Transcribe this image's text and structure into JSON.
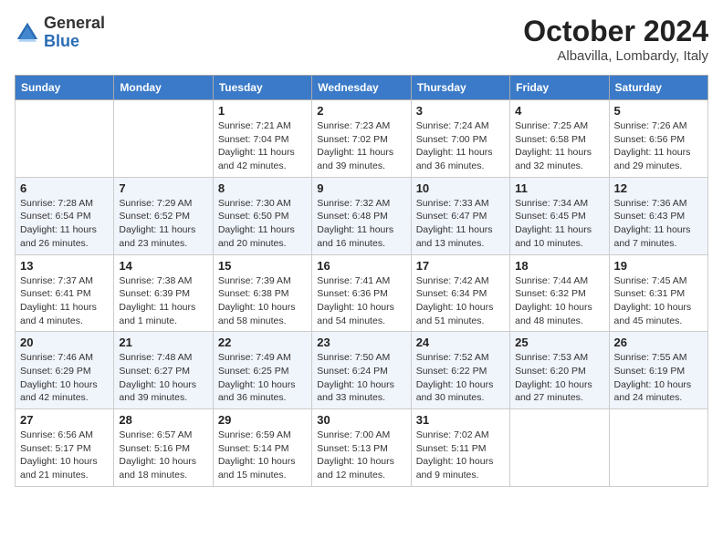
{
  "logo": {
    "general": "General",
    "blue": "Blue"
  },
  "title": "October 2024",
  "location": "Albavilla, Lombardy, Italy",
  "days_of_week": [
    "Sunday",
    "Monday",
    "Tuesday",
    "Wednesday",
    "Thursday",
    "Friday",
    "Saturday"
  ],
  "weeks": [
    [
      {
        "day": "",
        "details": ""
      },
      {
        "day": "",
        "details": ""
      },
      {
        "day": "1",
        "details": "Sunrise: 7:21 AM\nSunset: 7:04 PM\nDaylight: 11 hours and 42 minutes."
      },
      {
        "day": "2",
        "details": "Sunrise: 7:23 AM\nSunset: 7:02 PM\nDaylight: 11 hours and 39 minutes."
      },
      {
        "day": "3",
        "details": "Sunrise: 7:24 AM\nSunset: 7:00 PM\nDaylight: 11 hours and 36 minutes."
      },
      {
        "day": "4",
        "details": "Sunrise: 7:25 AM\nSunset: 6:58 PM\nDaylight: 11 hours and 32 minutes."
      },
      {
        "day": "5",
        "details": "Sunrise: 7:26 AM\nSunset: 6:56 PM\nDaylight: 11 hours and 29 minutes."
      }
    ],
    [
      {
        "day": "6",
        "details": "Sunrise: 7:28 AM\nSunset: 6:54 PM\nDaylight: 11 hours and 26 minutes."
      },
      {
        "day": "7",
        "details": "Sunrise: 7:29 AM\nSunset: 6:52 PM\nDaylight: 11 hours and 23 minutes."
      },
      {
        "day": "8",
        "details": "Sunrise: 7:30 AM\nSunset: 6:50 PM\nDaylight: 11 hours and 20 minutes."
      },
      {
        "day": "9",
        "details": "Sunrise: 7:32 AM\nSunset: 6:48 PM\nDaylight: 11 hours and 16 minutes."
      },
      {
        "day": "10",
        "details": "Sunrise: 7:33 AM\nSunset: 6:47 PM\nDaylight: 11 hours and 13 minutes."
      },
      {
        "day": "11",
        "details": "Sunrise: 7:34 AM\nSunset: 6:45 PM\nDaylight: 11 hours and 10 minutes."
      },
      {
        "day": "12",
        "details": "Sunrise: 7:36 AM\nSunset: 6:43 PM\nDaylight: 11 hours and 7 minutes."
      }
    ],
    [
      {
        "day": "13",
        "details": "Sunrise: 7:37 AM\nSunset: 6:41 PM\nDaylight: 11 hours and 4 minutes."
      },
      {
        "day": "14",
        "details": "Sunrise: 7:38 AM\nSunset: 6:39 PM\nDaylight: 11 hours and 1 minute."
      },
      {
        "day": "15",
        "details": "Sunrise: 7:39 AM\nSunset: 6:38 PM\nDaylight: 10 hours and 58 minutes."
      },
      {
        "day": "16",
        "details": "Sunrise: 7:41 AM\nSunset: 6:36 PM\nDaylight: 10 hours and 54 minutes."
      },
      {
        "day": "17",
        "details": "Sunrise: 7:42 AM\nSunset: 6:34 PM\nDaylight: 10 hours and 51 minutes."
      },
      {
        "day": "18",
        "details": "Sunrise: 7:44 AM\nSunset: 6:32 PM\nDaylight: 10 hours and 48 minutes."
      },
      {
        "day": "19",
        "details": "Sunrise: 7:45 AM\nSunset: 6:31 PM\nDaylight: 10 hours and 45 minutes."
      }
    ],
    [
      {
        "day": "20",
        "details": "Sunrise: 7:46 AM\nSunset: 6:29 PM\nDaylight: 10 hours and 42 minutes."
      },
      {
        "day": "21",
        "details": "Sunrise: 7:48 AM\nSunset: 6:27 PM\nDaylight: 10 hours and 39 minutes."
      },
      {
        "day": "22",
        "details": "Sunrise: 7:49 AM\nSunset: 6:25 PM\nDaylight: 10 hours and 36 minutes."
      },
      {
        "day": "23",
        "details": "Sunrise: 7:50 AM\nSunset: 6:24 PM\nDaylight: 10 hours and 33 minutes."
      },
      {
        "day": "24",
        "details": "Sunrise: 7:52 AM\nSunset: 6:22 PM\nDaylight: 10 hours and 30 minutes."
      },
      {
        "day": "25",
        "details": "Sunrise: 7:53 AM\nSunset: 6:20 PM\nDaylight: 10 hours and 27 minutes."
      },
      {
        "day": "26",
        "details": "Sunrise: 7:55 AM\nSunset: 6:19 PM\nDaylight: 10 hours and 24 minutes."
      }
    ],
    [
      {
        "day": "27",
        "details": "Sunrise: 6:56 AM\nSunset: 5:17 PM\nDaylight: 10 hours and 21 minutes."
      },
      {
        "day": "28",
        "details": "Sunrise: 6:57 AM\nSunset: 5:16 PM\nDaylight: 10 hours and 18 minutes."
      },
      {
        "day": "29",
        "details": "Sunrise: 6:59 AM\nSunset: 5:14 PM\nDaylight: 10 hours and 15 minutes."
      },
      {
        "day": "30",
        "details": "Sunrise: 7:00 AM\nSunset: 5:13 PM\nDaylight: 10 hours and 12 minutes."
      },
      {
        "day": "31",
        "details": "Sunrise: 7:02 AM\nSunset: 5:11 PM\nDaylight: 10 hours and 9 minutes."
      },
      {
        "day": "",
        "details": ""
      },
      {
        "day": "",
        "details": ""
      }
    ]
  ]
}
